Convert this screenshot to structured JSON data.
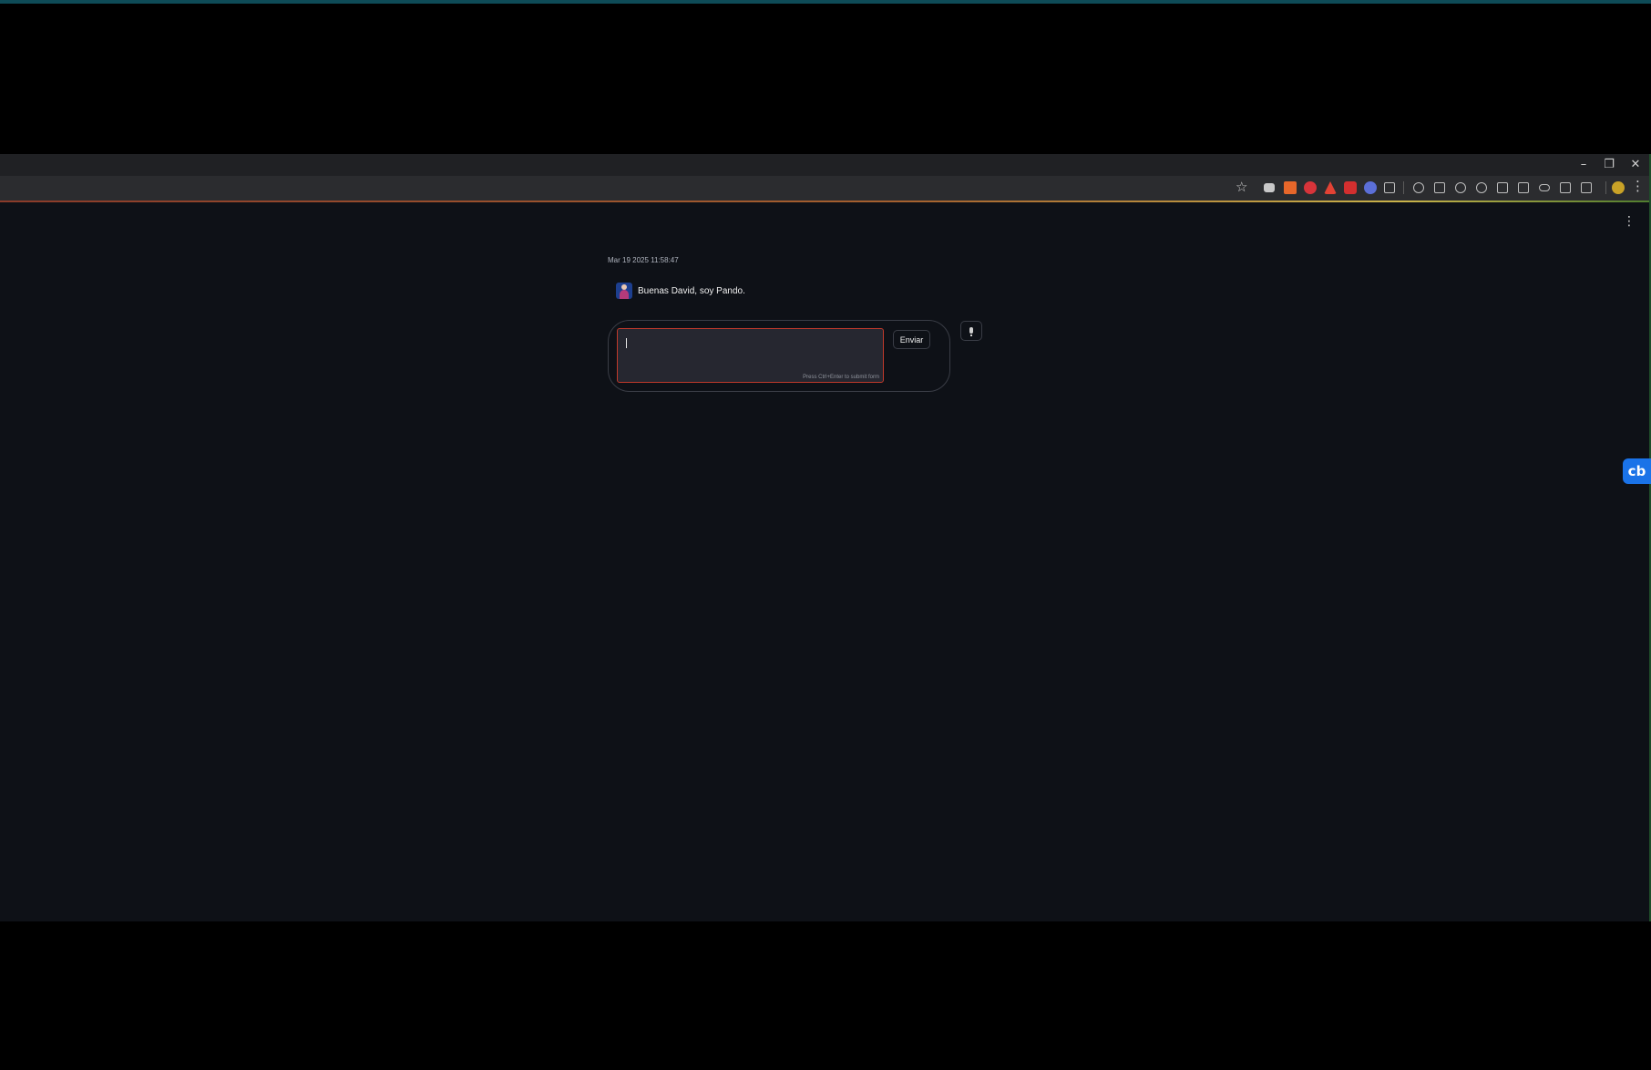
{
  "window": {
    "controls": {
      "minimize": "–",
      "restore": "❐",
      "close": "✕"
    }
  },
  "toolbar": {
    "icons": [
      {
        "name": "bookmark-star-icon",
        "glyph": "☆"
      },
      {
        "name": "extension-gray-icon",
        "color": "#c8c8c8"
      },
      {
        "name": "extension-orange-icon",
        "color": "#e8672a"
      },
      {
        "name": "extension-red-circle-icon",
        "color": "#d8343a"
      },
      {
        "name": "pdf-extension-icon",
        "color": "#e34234"
      },
      {
        "name": "extension-red-square-icon",
        "color": "#d32f2f"
      },
      {
        "name": "extension-blue-globe-icon",
        "color": "#5b6fd8"
      },
      {
        "name": "extension-puzzle-icon",
        "color": "#bdbdbd"
      },
      {
        "name": "key-icon",
        "color": "#bdbdbd"
      },
      {
        "name": "card-icon",
        "color": "#bdbdbd"
      },
      {
        "name": "history-icon",
        "color": "#bdbdbd"
      },
      {
        "name": "sync-icon",
        "color": "#bdbdbd"
      },
      {
        "name": "translate-icon",
        "color": "#bdbdbd"
      },
      {
        "name": "grid-icon",
        "color": "#bdbdbd"
      },
      {
        "name": "link-icon",
        "color": "#bdbdbd"
      },
      {
        "name": "sidebar-icon",
        "color": "#bdbdbd"
      },
      {
        "name": "screenshot-icon",
        "color": "#bdbdbd"
      },
      {
        "name": "profile-avatar-icon",
        "color": "#c9a227"
      },
      {
        "name": "browser-menu-icon",
        "glyph": "⋮"
      }
    ]
  },
  "app": {
    "menu_glyph": "⋮",
    "timestamp": "Mar 19 2025 11:58:47",
    "message": {
      "avatar": "assistant-avatar",
      "text": "Buenas David, soy Pando."
    },
    "form": {
      "input_value": "",
      "hint": "Press Ctrl+Enter to submit form",
      "send_label": "Enviar"
    },
    "mic_icon": "microphone-icon"
  },
  "side_badge": {
    "label": "cb"
  },
  "colors": {
    "app_background": "#0e1117",
    "textarea_border": "#c0392b",
    "badge_blue": "#1a73e8"
  }
}
